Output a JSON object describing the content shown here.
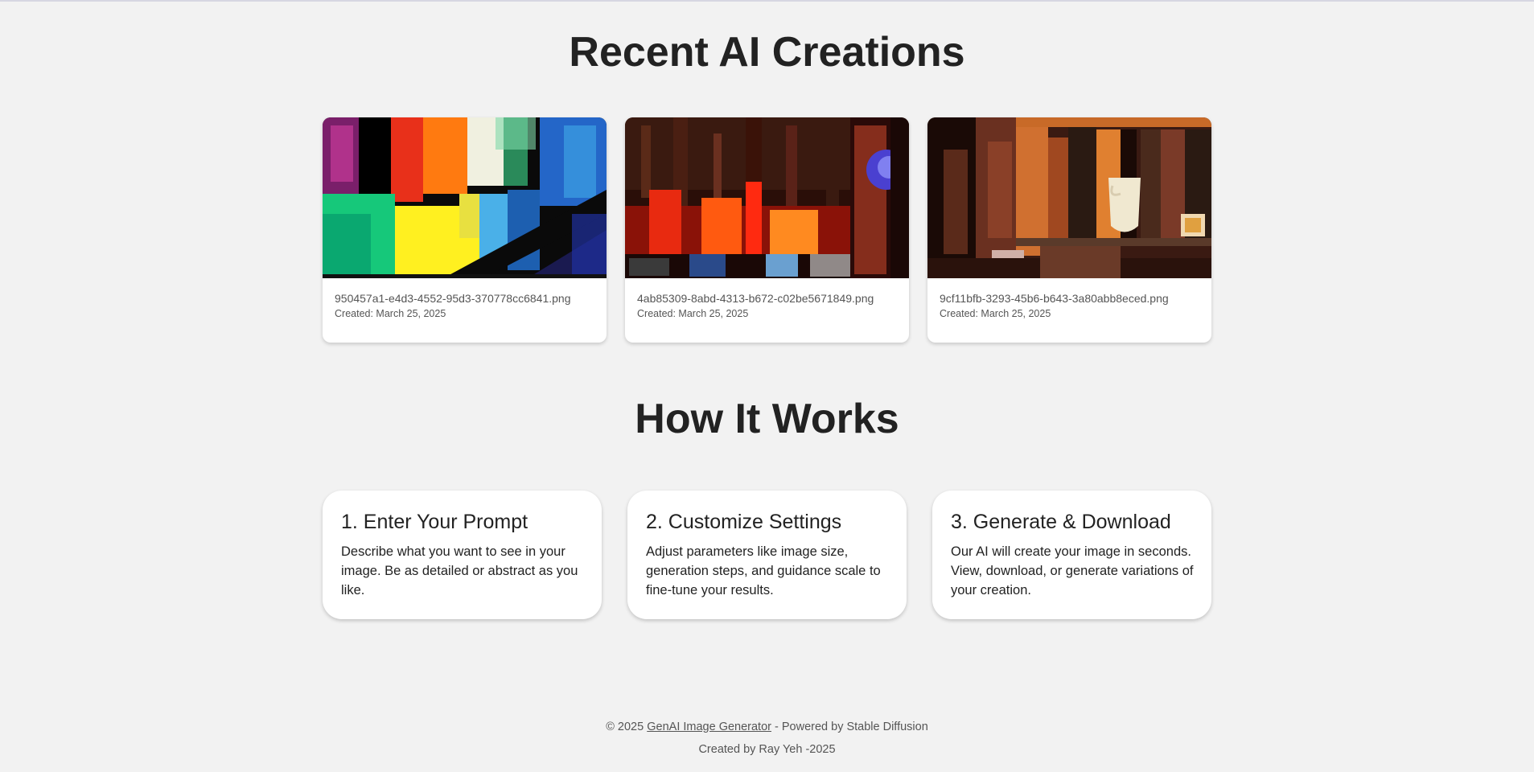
{
  "sections": {
    "recent_title": "Recent AI Creations",
    "how_title": "How It Works"
  },
  "gallery": [
    {
      "filename": "950457a1-e4d3-4552-95d3-370778cc6841.png",
      "created": "Created: March 25, 2025",
      "image_icon": "abstract-colorful-blocks-image"
    },
    {
      "filename": "4ab85309-8abd-4313-b672-c02be5671849.png",
      "created": "Created: March 25, 2025",
      "image_icon": "neon-city-lights-image"
    },
    {
      "filename": "9cf11bfb-3293-45b6-b643-3a80abb8eced.png",
      "created": "Created: March 25, 2025",
      "image_icon": "bookshelf-interior-image"
    }
  ],
  "steps": [
    {
      "title": "1. Enter Your Prompt",
      "desc": "Describe what you want to see in your image. Be as detailed or abstract as you like."
    },
    {
      "title": "2. Customize Settings",
      "desc": "Adjust parameters like image size, generation steps, and guidance scale to fine-tune your results."
    },
    {
      "title": "3. Generate & Download",
      "desc": "Our AI will create your image in seconds. View, download, or generate variations of your creation."
    }
  ],
  "footer": {
    "copyright_prefix": "© 2025",
    "brand_link": "GenAI Image Generator",
    "powered_by": "- Powered by Stable Diffusion",
    "credit": "Created by Ray Yeh -2025"
  },
  "colors": {
    "background": "#f2f2f2",
    "card": "#ffffff",
    "heading": "#222222",
    "muted": "#555555"
  }
}
